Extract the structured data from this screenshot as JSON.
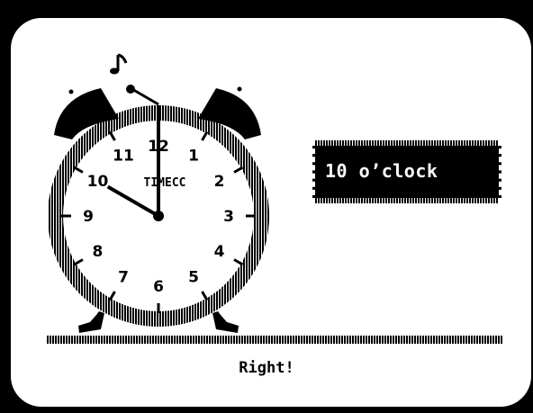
{
  "clock": {
    "brand": "TIMECC",
    "numbers": [
      "12",
      "1",
      "2",
      "3",
      "4",
      "5",
      "6",
      "7",
      "8",
      "9",
      "10",
      "11"
    ],
    "time": {
      "hour": 10,
      "minute": 0
    },
    "icon": "music-note-icon"
  },
  "answer": {
    "label": "10 o’clock"
  },
  "feedback": {
    "message": "Right!"
  },
  "colors": {
    "screen": "#ffffff",
    "ink": "#000000",
    "bezel": "#000000"
  }
}
